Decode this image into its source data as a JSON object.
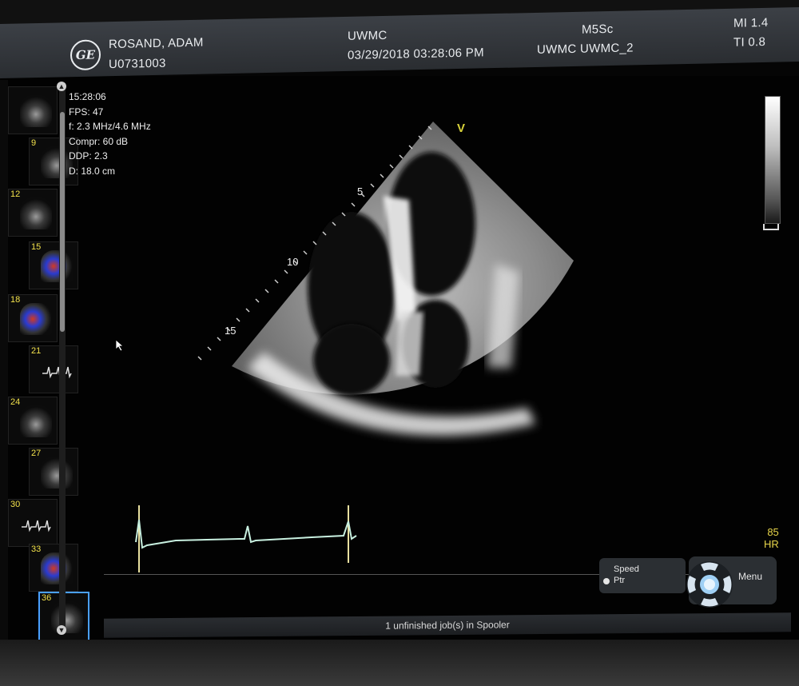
{
  "header": {
    "patient_name": "ROSAND, ADAM",
    "patient_id": "U0731003",
    "institution": "UWMC",
    "datetime": "03/29/2018 03:28:06 PM",
    "probe": "M5Sc",
    "station": "UWMC  UWMC_2",
    "mi": "MI 1.4",
    "ti": "TI 0.8"
  },
  "params": {
    "time": "15:28:06",
    "fps": "FPS: 47",
    "frequency": "f: 2.3 MHz/4.6 MHz",
    "compression": "Compr: 60 dB",
    "ddp": "DDP: 2.3",
    "depth": "D: 18.0 cm"
  },
  "depth_marks": [
    "5",
    "10",
    "15"
  ],
  "orientation_marker": "V",
  "heart_rate": {
    "value": "85",
    "label": "HR"
  },
  "thumbnails": [
    {
      "num": "",
      "type": "gray"
    },
    {
      "num": "9",
      "type": "gray"
    },
    {
      "num": "12",
      "type": "gray"
    },
    {
      "num": "15",
      "type": "color"
    },
    {
      "num": "18",
      "type": "color"
    },
    {
      "num": "21",
      "type": "ecg"
    },
    {
      "num": "24",
      "type": "gray"
    },
    {
      "num": "27",
      "type": "gray"
    },
    {
      "num": "30",
      "type": "ecg"
    },
    {
      "num": "33",
      "type": "color"
    },
    {
      "num": "36",
      "type": "gray"
    }
  ],
  "controls": {
    "speed_label": "Speed",
    "ptr_label": "Ptr",
    "menu_label": "Menu"
  },
  "status": "1 unfinished job(s) in Spooler",
  "colors": {
    "thumb_number": "#f2e14b",
    "ecg_trace": "#c8f0e0",
    "hr_text": "#e8d64a",
    "selected_border": "#4aa0ff"
  }
}
